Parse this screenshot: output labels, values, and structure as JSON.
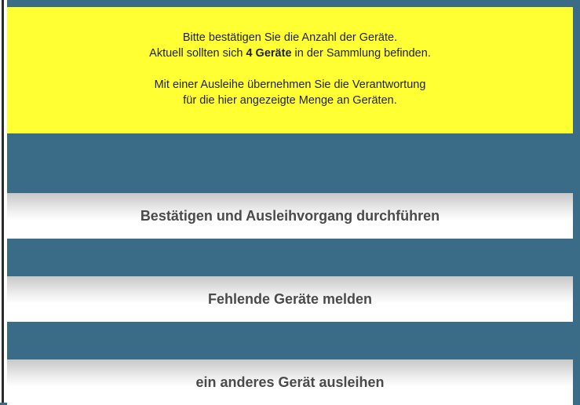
{
  "notice": {
    "line1": "Bitte bestätigen Sie die Anzahl der Geräte.",
    "line2_prefix": "Aktuell sollten sich ",
    "line2_count": "4 Geräte",
    "line2_suffix": " in der Sammlung befinden.",
    "line3": "Mit einer Ausleihe übernehmen Sie die Verantwortung",
    "line4": "für die hier angezeigte Menge an Geräten."
  },
  "actions": {
    "confirm_label": "Bestätigen und Ausleihvorgang durchführen",
    "report_label": "Fehlende Geräte melden",
    "other_label": "ein anderes Gerät ausleihen"
  },
  "colors": {
    "background": "#3a6b87",
    "notice_background": "#ffff33",
    "button_text": "#4a4a4a"
  }
}
